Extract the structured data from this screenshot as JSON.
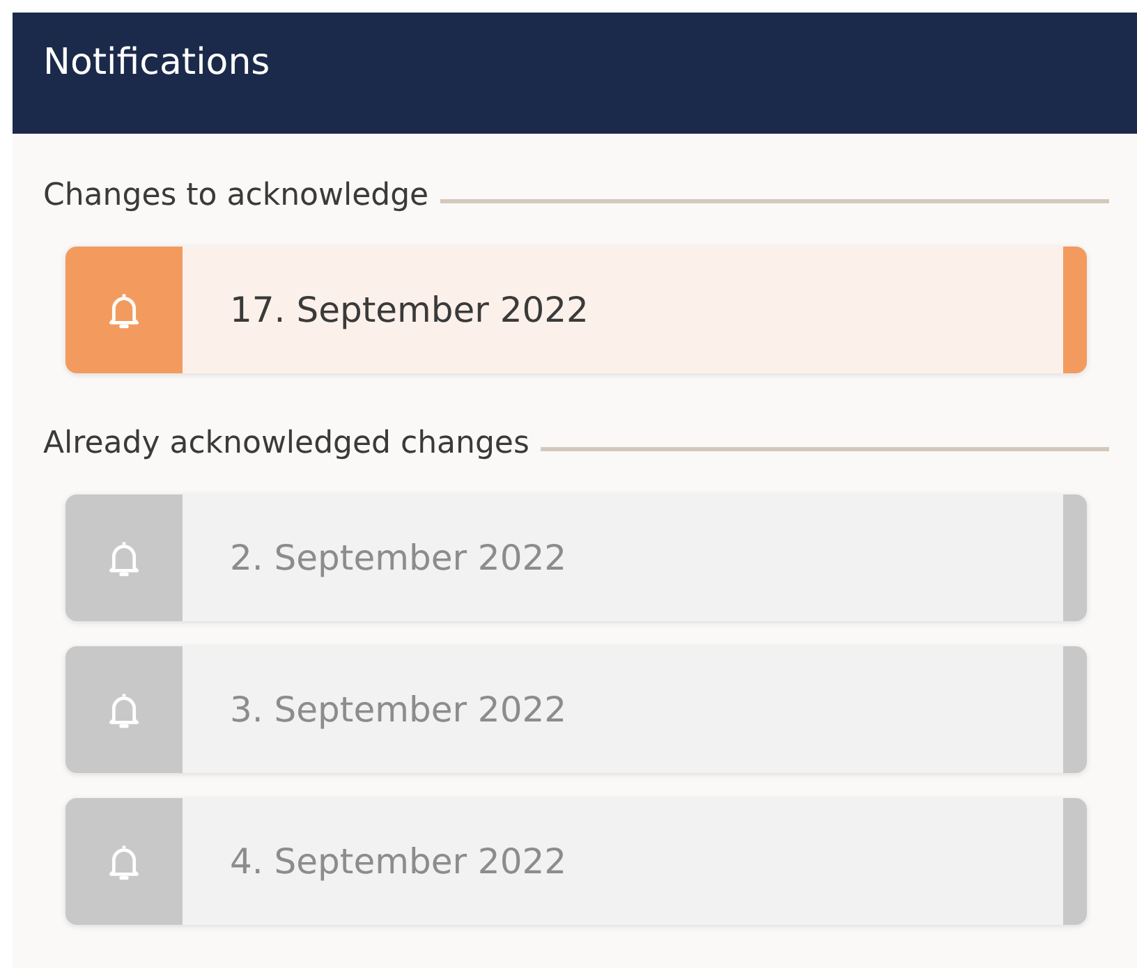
{
  "header": {
    "title": "Notifications"
  },
  "sections": [
    {
      "heading": "Changes to acknowledge",
      "items": [
        {
          "date": "17. September 2022",
          "acknowledged": false
        }
      ]
    },
    {
      "heading": "Already acknowledged changes",
      "items": [
        {
          "date": "2. September 2022",
          "acknowledged": true
        },
        {
          "date": "3. September 2022",
          "acknowledged": true
        },
        {
          "date": "4. September 2022",
          "acknowledged": true
        }
      ]
    }
  ]
}
